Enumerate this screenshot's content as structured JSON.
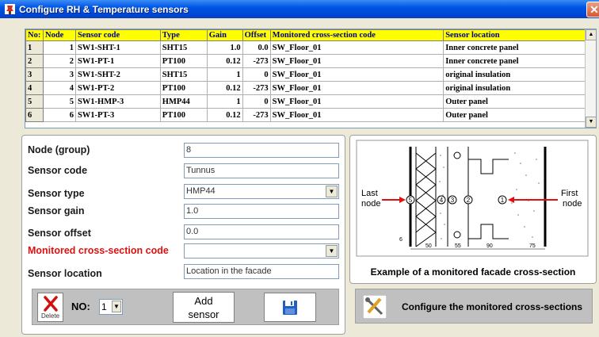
{
  "window": {
    "title": "Configure RH & Temperature sensors",
    "close_glyph": "✕"
  },
  "table": {
    "headers": [
      "No:",
      "Node",
      "Sensor code",
      "Type",
      "Gain",
      "Offset",
      "Monitored cross-section code",
      "Sensor location"
    ],
    "rows": [
      {
        "no": "1",
        "node": "1",
        "code": "SW1-SHT-1",
        "type": "SHT15",
        "gain": "1.0",
        "offset": "0.0",
        "section": "SW_Floor_01",
        "location": "Inner concrete panel"
      },
      {
        "no": "2",
        "node": "2",
        "code": "SW1-PT-1",
        "type": "PT100",
        "gain": "0.12",
        "offset": "-273",
        "section": "SW_Floor_01",
        "location": "Inner concrete panel"
      },
      {
        "no": "3",
        "node": "3",
        "code": "SW1-SHT-2",
        "type": "SHT15",
        "gain": "1",
        "offset": "0",
        "section": "SW_Floor_01",
        "location": "original insulation"
      },
      {
        "no": "4",
        "node": "4",
        "code": "SW1-PT-2",
        "type": "PT100",
        "gain": "0.12",
        "offset": "-273",
        "section": "SW_Floor_01",
        "location": "original insulation"
      },
      {
        "no": "5",
        "node": "5",
        "code": "SW1-HMP-3",
        "type": "HMP44",
        "gain": "1",
        "offset": "0",
        "section": "SW_Floor_01",
        "location": "Outer panel"
      },
      {
        "no": "6",
        "node": "6",
        "code": "SW1-PT-3",
        "type": "PT100",
        "gain": "0.12",
        "offset": "-273",
        "section": "SW_Floor_01",
        "location": "Outer panel"
      }
    ]
  },
  "form": {
    "node_label": "Node (group)",
    "node_value": "8",
    "code_label": "Sensor code",
    "code_value": "Tunnus",
    "type_label": "Sensor type",
    "type_value": "HMP44",
    "gain_label": "Sensor gain",
    "gain_value": "1.0",
    "offset_label": "Sensor offset",
    "offset_value": "0.0",
    "section_label": "Monitored cross-section code",
    "section_value": "",
    "location_label": "Sensor location",
    "location_value": "Location in the facade"
  },
  "actions": {
    "delete_label": "Delete",
    "no_label": "NO:",
    "no_value": "1",
    "add_label_1": "Add",
    "add_label_2": "sensor"
  },
  "diagram": {
    "last_node": "Last",
    "last_node_2": "node",
    "first_node": "First",
    "first_node_2": "node",
    "markers": [
      "5",
      "4",
      "3",
      "2",
      "1"
    ],
    "side_mark": "6",
    "dims": [
      "50",
      "55",
      "90",
      "75"
    ],
    "caption": "Example of a monitored facade cross-section"
  },
  "configure": {
    "label": "Configure the monitored cross-sections"
  },
  "colors": {
    "header_bg": "#FFFF00",
    "header_text": "#000080",
    "warning_label": "#E01010",
    "arrow": "#E01010"
  }
}
